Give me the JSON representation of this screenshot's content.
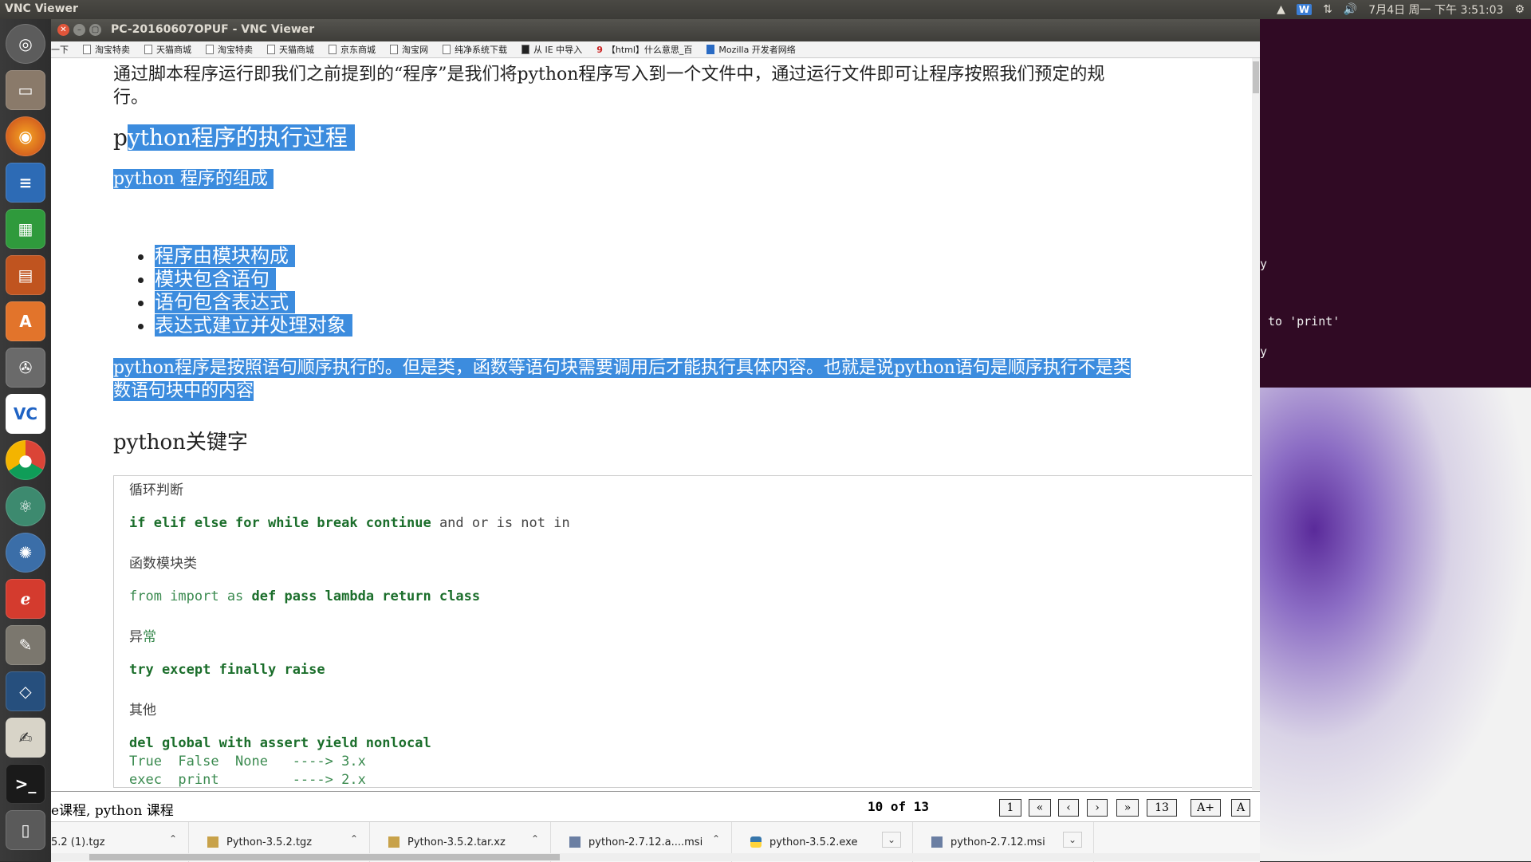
{
  "top_panel": {
    "app_title": "VNC Viewer",
    "wps_label": "W",
    "clock": "7月4日 周一 下午 3:51:03"
  },
  "launcher": {
    "items": [
      "dash-home",
      "files",
      "firefox",
      "writer",
      "calc",
      "impress",
      "software-center",
      "system-settings",
      "vnc-viewer",
      "chrome",
      "atom",
      "browser",
      "text-editor",
      "gimp",
      "virtualbox",
      "gedit",
      "terminal",
      "trash"
    ],
    "vnc_label": "VC"
  },
  "terminal_bg": {
    "lines": [
      "y",
      "to 'print'",
      "y"
    ]
  },
  "window": {
    "title": "PC-20160607OPUF - VNC Viewer"
  },
  "bookmarks": {
    "items": [
      "一下",
      "淘宝特卖",
      "天猫商城",
      "淘宝特卖",
      "天猫商城",
      "京东商城",
      "淘宝网",
      "纯净系统下载",
      "从 IE 中导入",
      "【html】什么意思_百",
      "Mozilla 开发者网络"
    ]
  },
  "document": {
    "intro_line1": "通过脚本程序运行即我们之前提到的“程序”是我们将python程序写入到一个文件中，通过运行文件即可让程序按照我们预定的规",
    "intro_line2": "行。",
    "heading_exec_first": "p",
    "heading_exec_rest": "ython程序的执行过程",
    "heading_components": "python 程序的组成",
    "list": [
      "程序由模块构成",
      "模块包含语句",
      "语句包含表达式",
      "表达式建立并处理对象"
    ],
    "para_line1": "python程序是按照语句顺序执行的。但是类，函数等语句块需要调用后才能执行具体内容。也就是说python语句是顺序执行不是类",
    "para_line2": "数语句块中的内容",
    "heading_keywords": "python关键字",
    "code": {
      "c1": "循环判断",
      "c2": "if elif else for while break continue",
      "c2b": " and or is not in",
      "c3": "函数模块类",
      "c4a": "from import as",
      "c4b": " def pass lambda return class",
      "c5a": "异",
      "c5b": "常",
      "c6": "try except finally raise",
      "c7": "其他",
      "c8": "del global with assert yield nonlocal",
      "c9": "True  False  None   ----> 3.x",
      "c10": "exec  print         ----> 2.x"
    }
  },
  "pager": {
    "tags": "e课程, python 课程",
    "position": "10 of 13",
    "first": "1",
    "prev_prev": "«",
    "prev": "‹",
    "next": "›",
    "next_next": "»",
    "last": "13",
    "font_up": "A+",
    "font_reset": "A"
  },
  "downloads": {
    "items": [
      "5.2 (1).tgz",
      "Python-3.5.2.tgz",
      "Python-3.5.2.tar.xz",
      "python-2.7.12.a....msi",
      "python-3.5.2.exe",
      "python-2.7.12.msi"
    ]
  }
}
